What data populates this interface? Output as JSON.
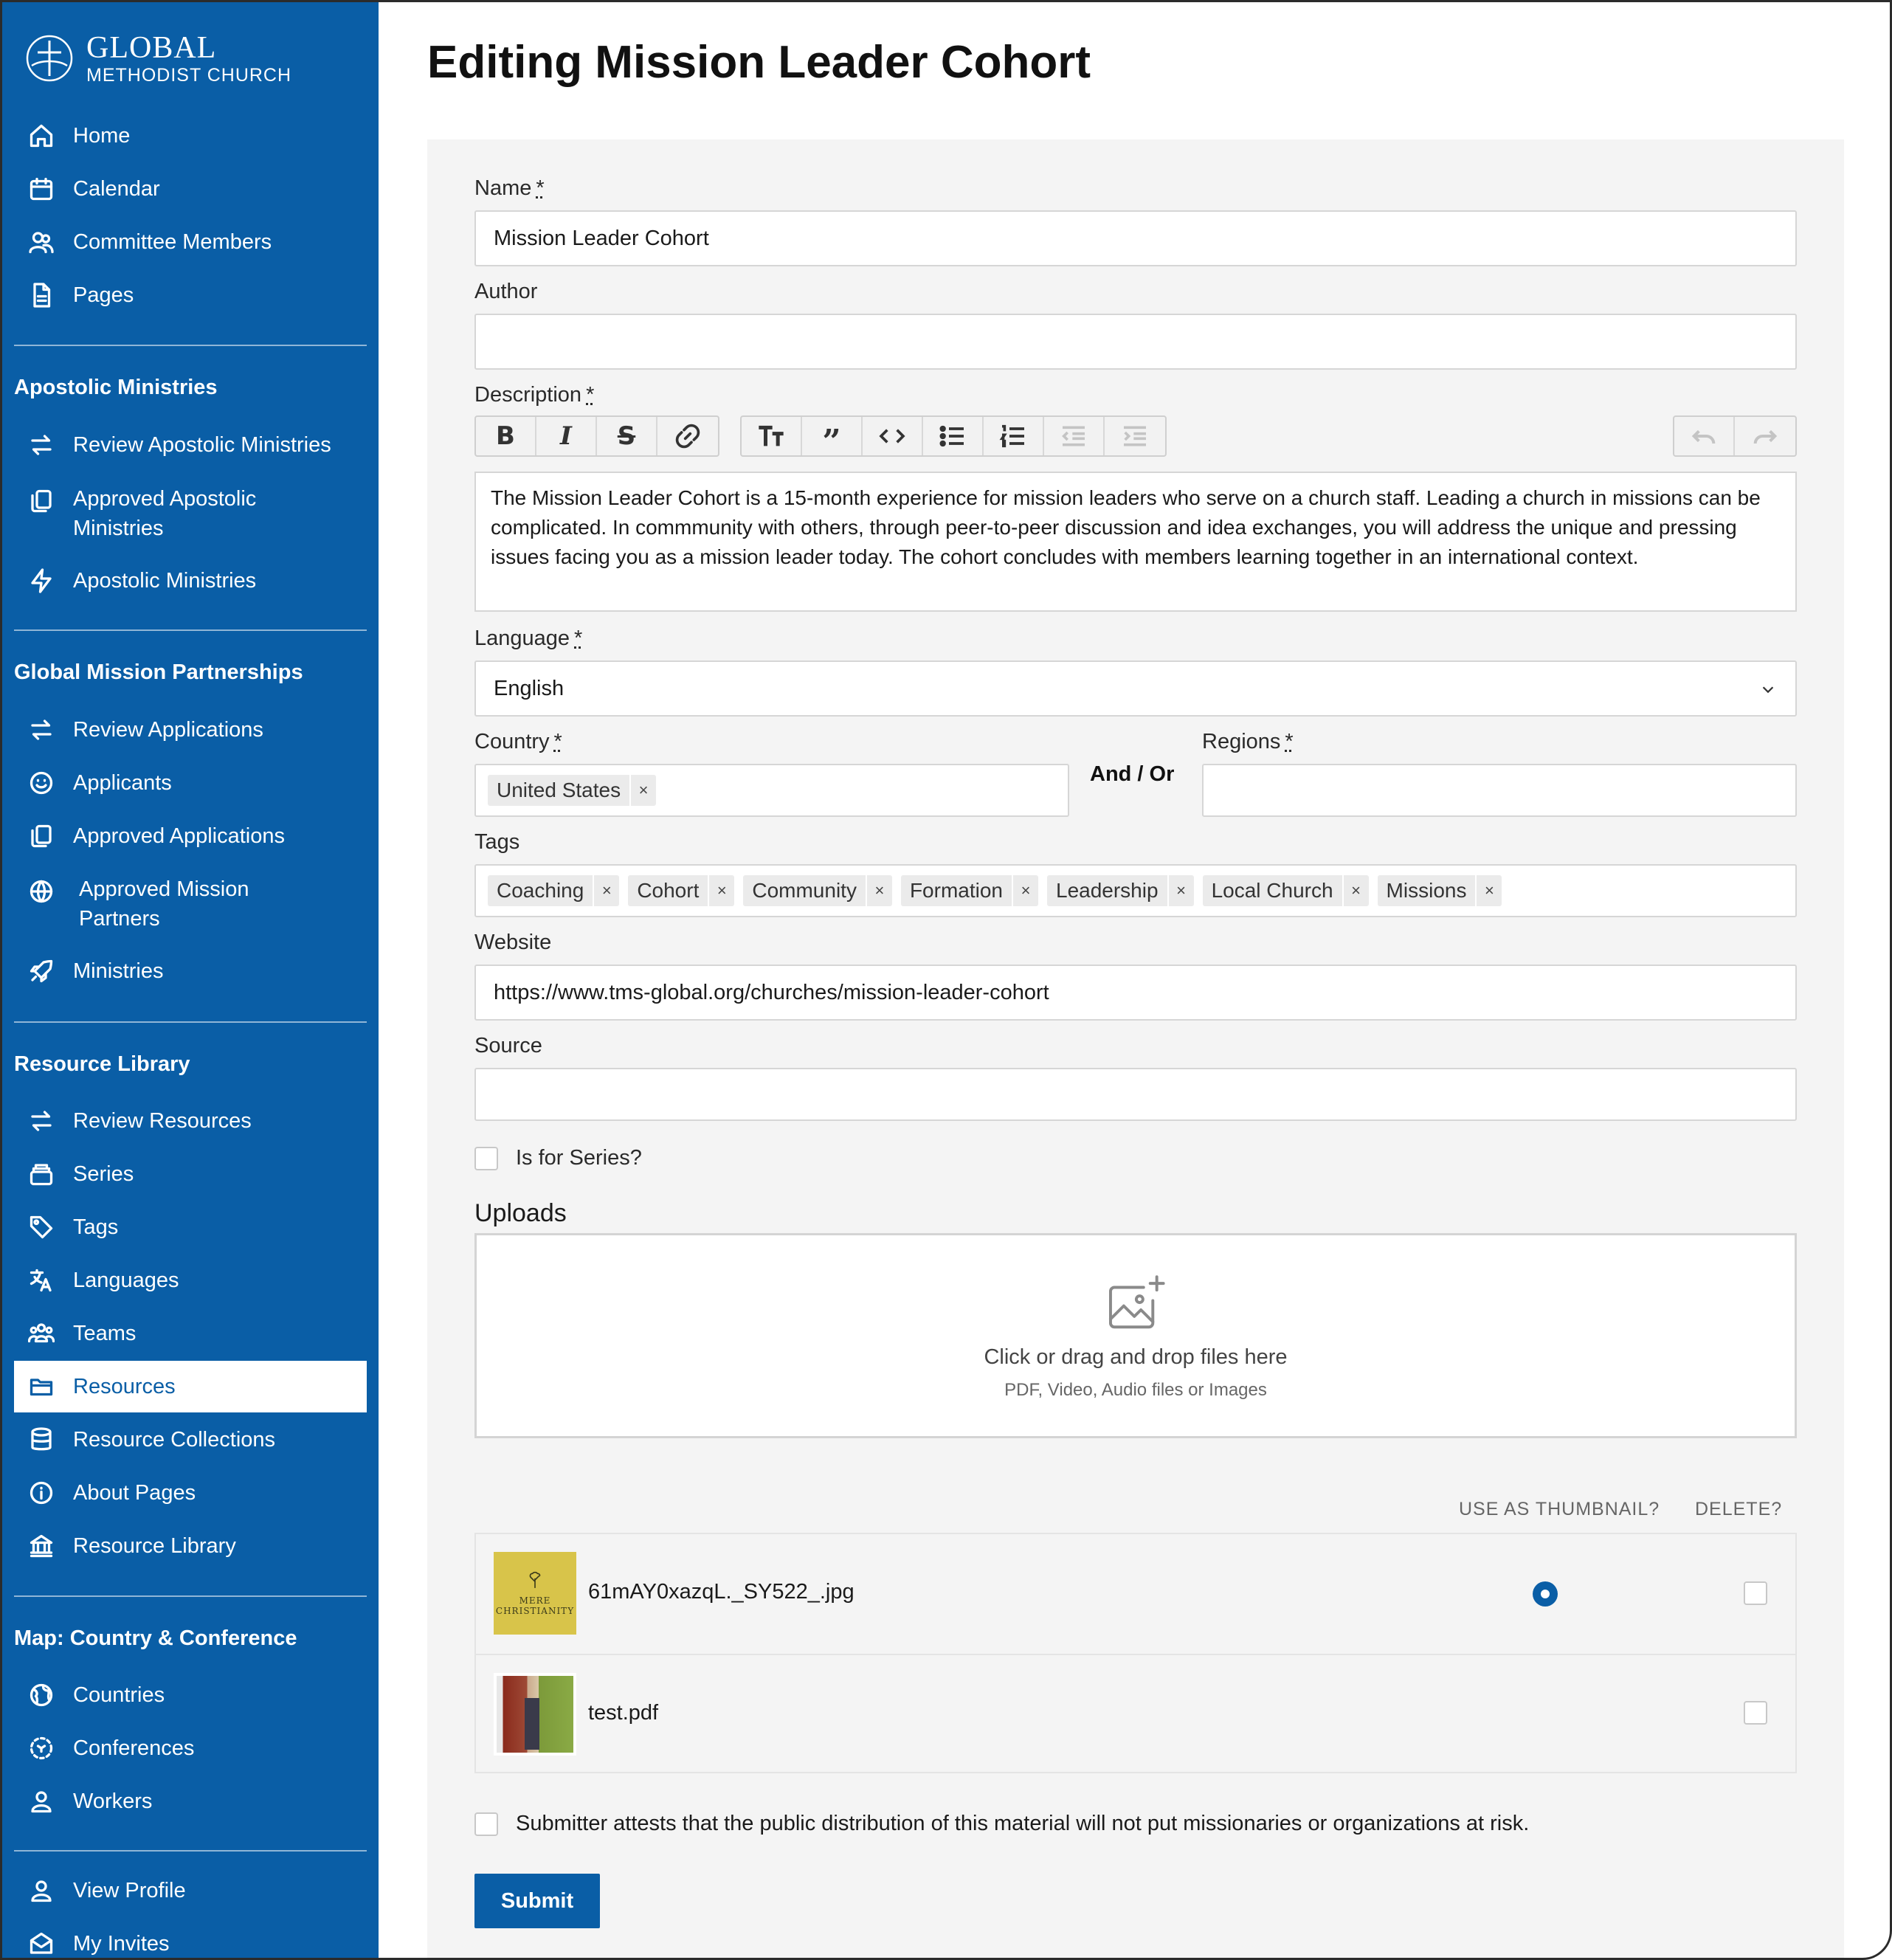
{
  "brand": {
    "line1": "GLOBAL",
    "line2": "METHODIST CHURCH"
  },
  "sidebar": {
    "main": [
      {
        "label": "Home",
        "icon": "home-icon"
      },
      {
        "label": "Calendar",
        "icon": "calendar-icon"
      },
      {
        "label": "Committee Members",
        "icon": "users-icon"
      },
      {
        "label": "Pages",
        "icon": "document-icon"
      }
    ],
    "sections": [
      {
        "title": "Apostolic Ministries",
        "items": [
          {
            "label": "Review Apostolic Ministries",
            "icon": "swap-icon"
          },
          {
            "label": "Approved Apostolic Ministries",
            "icon": "copy-icon"
          },
          {
            "label": "Apostolic Ministries",
            "icon": "bolt-icon"
          }
        ]
      },
      {
        "title": "Global Mission Partnerships",
        "items": [
          {
            "label": "Review Applications",
            "icon": "swap-icon"
          },
          {
            "label": "Applicants",
            "icon": "smile-icon"
          },
          {
            "label": "Approved Applications",
            "icon": "copy-icon"
          },
          {
            "label": "Approved Mission Partners",
            "icon": "globe-icon"
          },
          {
            "label": "Ministries",
            "icon": "rocket-icon"
          }
        ]
      },
      {
        "title": "Resource Library",
        "items": [
          {
            "label": "Review Resources",
            "icon": "swap-icon"
          },
          {
            "label": "Series",
            "icon": "stack-icon"
          },
          {
            "label": "Tags",
            "icon": "tag-icon"
          },
          {
            "label": "Languages",
            "icon": "translate-icon"
          },
          {
            "label": "Teams",
            "icon": "team-icon"
          },
          {
            "label": "Resources",
            "icon": "folder-icon",
            "active": true
          },
          {
            "label": "Resource Collections",
            "icon": "database-icon"
          },
          {
            "label": "About Pages",
            "icon": "info-icon"
          },
          {
            "label": "Resource Library",
            "icon": "library-icon"
          }
        ]
      },
      {
        "title": "Map: Country & Conference",
        "items": [
          {
            "label": "Countries",
            "icon": "earth-icon"
          },
          {
            "label": "Conferences",
            "icon": "dashed-circle-icon"
          },
          {
            "label": "Workers",
            "icon": "user-icon"
          }
        ]
      }
    ],
    "footer": [
      {
        "label": "View Profile",
        "icon": "user-icon"
      },
      {
        "label": "My Invites",
        "icon": "mail-icon"
      }
    ]
  },
  "page": {
    "title": "Editing Mission Leader Cohort"
  },
  "form": {
    "name": {
      "label": "Name",
      "required": "*",
      "value": "Mission Leader Cohort"
    },
    "author": {
      "label": "Author",
      "value": ""
    },
    "description": {
      "label": "Description",
      "required": "*",
      "value": "The Mission Leader Cohort is a 15-month experience for mission leaders who serve on a church staff. Leading a church in missions can be complicated.  In commmunity with others, through peer-to-peer discussion and idea exchanges, you will address the unique and pressing issues facing you as a mission leader today. The cohort concludes with members learning together in an international context."
    },
    "language": {
      "label": "Language",
      "required": "*",
      "value": "English"
    },
    "country": {
      "label": "Country",
      "required": "*",
      "chips": [
        "United States"
      ]
    },
    "and_or": "And / Or",
    "regions": {
      "label": "Regions",
      "required": "*"
    },
    "tags": {
      "label": "Tags",
      "chips": [
        "Coaching",
        "Cohort",
        "Community",
        "Formation",
        "Leadership",
        "Local Church",
        "Missions"
      ]
    },
    "website": {
      "label": "Website",
      "value": "https://www.tms-global.org/churches/mission-leader-cohort"
    },
    "source": {
      "label": "Source",
      "value": ""
    },
    "series": {
      "label": "Is for Series?"
    },
    "uploads": {
      "title": "Uploads",
      "drop_main": "Click or drag and drop files here",
      "drop_sub": "PDF, Video, Audio files or Images",
      "col_thumb": "USE AS THUMBNAIL?",
      "col_delete": "DELETE?",
      "files": [
        {
          "name": "61mAY0xazqL._SY522_.jpg",
          "thumb_text_1": "MERE",
          "thumb_text_2": "CHRISTIANITY",
          "thumbnail": true
        },
        {
          "name": "test.pdf",
          "thumbnail": false
        }
      ]
    },
    "attest": "Submitter attests that the public distribution of this material will not put missionaries or organizations at risk.",
    "submit": "Submit"
  },
  "colors": {
    "brand": "#0a5ea6",
    "panel": "#f4f4f4"
  }
}
